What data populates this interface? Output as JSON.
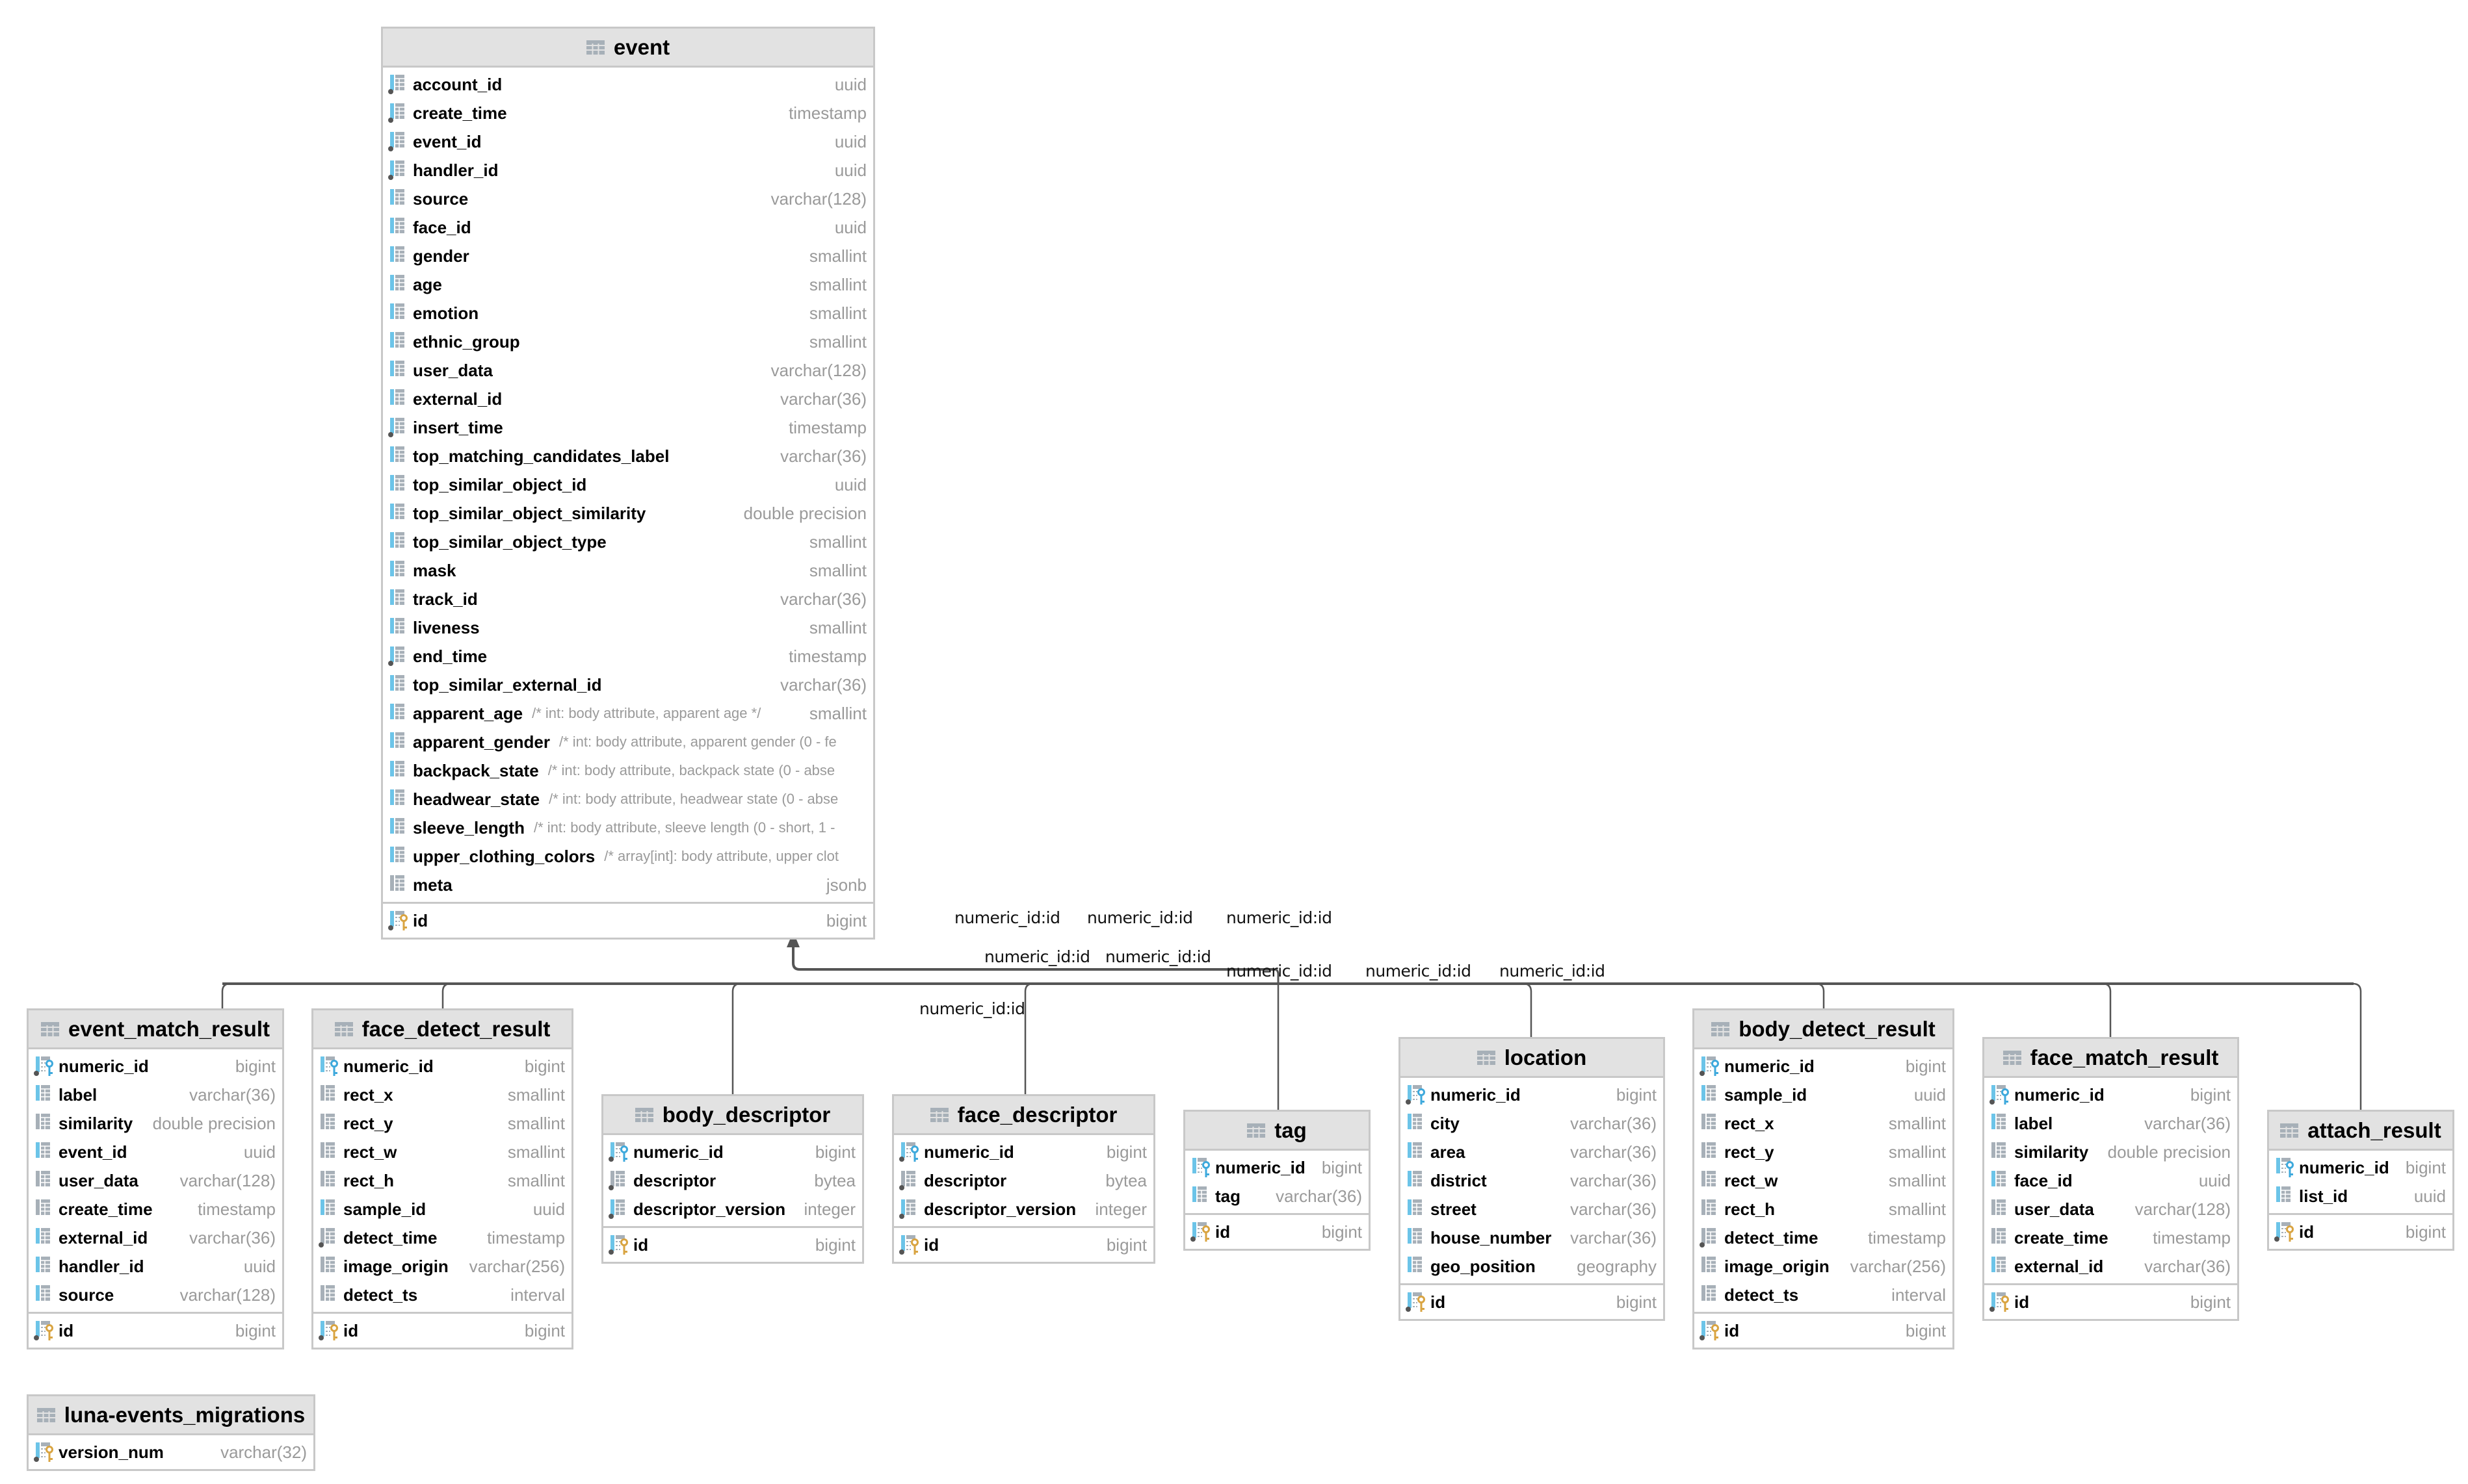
{
  "diagram": {
    "relationship_label": "numeric_id:id",
    "colors": {
      "header_bg": "#e2e2e2",
      "border": "#c8c8c8",
      "type_text": "#9a9a9a",
      "line": "#555555",
      "column_accent_blue": "#6cc4e8",
      "column_accent_gray": "#a7b0b8",
      "pk_key": "#d9a441",
      "fk_key": "#3ea9dc"
    }
  },
  "tables": {
    "event": {
      "title": "event",
      "columns": [
        {
          "name": "account_id",
          "type": "uuid",
          "icon": "column-indexed-notnull"
        },
        {
          "name": "create_time",
          "type": "timestamp",
          "icon": "column-indexed-notnull"
        },
        {
          "name": "event_id",
          "type": "uuid",
          "icon": "column-indexed-notnull"
        },
        {
          "name": "handler_id",
          "type": "uuid",
          "icon": "column-indexed-notnull"
        },
        {
          "name": "source",
          "type": "varchar(128)",
          "icon": "column-notnull"
        },
        {
          "name": "face_id",
          "type": "uuid",
          "icon": "column-notnull"
        },
        {
          "name": "gender",
          "type": "smallint",
          "icon": "column-notnull"
        },
        {
          "name": "age",
          "type": "smallint",
          "icon": "column-notnull"
        },
        {
          "name": "emotion",
          "type": "smallint",
          "icon": "column-notnull"
        },
        {
          "name": "ethnic_group",
          "type": "smallint",
          "icon": "column-notnull"
        },
        {
          "name": "user_data",
          "type": "varchar(128)",
          "icon": "column-notnull"
        },
        {
          "name": "external_id",
          "type": "varchar(36)",
          "icon": "column-notnull"
        },
        {
          "name": "insert_time",
          "type": "timestamp",
          "icon": "column-indexed-notnull"
        },
        {
          "name": "top_matching_candidates_label",
          "type": "varchar(36)",
          "icon": "column-notnull"
        },
        {
          "name": "top_similar_object_id",
          "type": "uuid",
          "icon": "column-notnull"
        },
        {
          "name": "top_similar_object_similarity",
          "type": "double precision",
          "icon": "column-notnull"
        },
        {
          "name": "top_similar_object_type",
          "type": "smallint",
          "icon": "column-notnull"
        },
        {
          "name": "mask",
          "type": "smallint",
          "icon": "column-notnull"
        },
        {
          "name": "track_id",
          "type": "varchar(36)",
          "icon": "column-notnull"
        },
        {
          "name": "liveness",
          "type": "smallint",
          "icon": "column-notnull"
        },
        {
          "name": "end_time",
          "type": "timestamp",
          "icon": "column-indexed-notnull"
        },
        {
          "name": "top_similar_external_id",
          "type": "varchar(36)",
          "icon": "column-notnull"
        },
        {
          "name": "apparent_age",
          "comment": "/* int: body attribute, apparent age */",
          "type": "smallint",
          "icon": "column-notnull"
        },
        {
          "name": "apparent_gender",
          "comment": "/* int: body attribute, apparent gender (0 - fe",
          "type": "",
          "icon": "column-notnull"
        },
        {
          "name": "backpack_state",
          "comment": "/* int: body attribute, backpack state (0 - abse",
          "type": "",
          "icon": "column-notnull"
        },
        {
          "name": "headwear_state",
          "comment": "/* int: body attribute, headwear state (0 - abse",
          "type": "",
          "icon": "column-notnull"
        },
        {
          "name": "sleeve_length",
          "comment": "/* int: body attribute, sleeve length (0 - short, 1 -",
          "type": "",
          "icon": "column-notnull"
        },
        {
          "name": "upper_clothing_colors",
          "comment": "/* array[int]: body attribute, upper clot",
          "type": "",
          "icon": "column-notnull"
        },
        {
          "name": "meta",
          "type": "jsonb",
          "icon": "column"
        }
      ],
      "pk": [
        {
          "name": "id",
          "type": "bigint",
          "icon": "primary-key"
        }
      ]
    },
    "event_match_result": {
      "title": "event_match_result",
      "columns": [
        {
          "name": "numeric_id",
          "type": "bigint",
          "icon": "foreign-key"
        },
        {
          "name": "label",
          "type": "varchar(36)",
          "icon": "column-notnull"
        },
        {
          "name": "similarity",
          "type": "double precision",
          "icon": "column"
        },
        {
          "name": "event_id",
          "type": "uuid",
          "icon": "column-notnull"
        },
        {
          "name": "user_data",
          "type": "varchar(128)",
          "icon": "column"
        },
        {
          "name": "create_time",
          "type": "timestamp",
          "icon": "column"
        },
        {
          "name": "external_id",
          "type": "varchar(36)",
          "icon": "column-notnull"
        },
        {
          "name": "handler_id",
          "type": "uuid",
          "icon": "column-notnull"
        },
        {
          "name": "source",
          "type": "varchar(128)",
          "icon": "column-notnull"
        }
      ],
      "pk": [
        {
          "name": "id",
          "type": "bigint",
          "icon": "primary-key"
        }
      ]
    },
    "face_detect_result": {
      "title": "face_detect_result",
      "columns": [
        {
          "name": "numeric_id",
          "type": "bigint",
          "icon": "foreign-key-nn"
        },
        {
          "name": "rect_x",
          "type": "smallint",
          "icon": "column"
        },
        {
          "name": "rect_y",
          "type": "smallint",
          "icon": "column"
        },
        {
          "name": "rect_w",
          "type": "smallint",
          "icon": "column"
        },
        {
          "name": "rect_h",
          "type": "smallint",
          "icon": "column"
        },
        {
          "name": "sample_id",
          "type": "uuid",
          "icon": "column-notnull"
        },
        {
          "name": "detect_time",
          "type": "timestamp",
          "icon": "column-indexed"
        },
        {
          "name": "image_origin",
          "type": "varchar(256)",
          "icon": "column"
        },
        {
          "name": "detect_ts",
          "type": "interval",
          "icon": "column"
        }
      ],
      "pk": [
        {
          "name": "id",
          "type": "bigint",
          "icon": "primary-key"
        }
      ]
    },
    "body_descriptor": {
      "title": "body_descriptor",
      "columns": [
        {
          "name": "numeric_id",
          "type": "bigint",
          "icon": "foreign-key"
        },
        {
          "name": "descriptor",
          "type": "bytea",
          "icon": "column-indexed"
        },
        {
          "name": "descriptor_version",
          "type": "integer",
          "icon": "column-indexed-notnull"
        }
      ],
      "pk": [
        {
          "name": "id",
          "type": "bigint",
          "icon": "primary-key"
        }
      ]
    },
    "face_descriptor": {
      "title": "face_descriptor",
      "columns": [
        {
          "name": "numeric_id",
          "type": "bigint",
          "icon": "foreign-key"
        },
        {
          "name": "descriptor",
          "type": "bytea",
          "icon": "column-indexed"
        },
        {
          "name": "descriptor_version",
          "type": "integer",
          "icon": "column-indexed-notnull"
        }
      ],
      "pk": [
        {
          "name": "id",
          "type": "bigint",
          "icon": "primary-key"
        }
      ]
    },
    "tag": {
      "title": "tag",
      "columns": [
        {
          "name": "numeric_id",
          "type": "bigint",
          "icon": "foreign-key-nn"
        },
        {
          "name": "tag",
          "type": "varchar(36)",
          "icon": "column-notnull"
        }
      ],
      "pk": [
        {
          "name": "id",
          "type": "bigint",
          "icon": "primary-key"
        }
      ]
    },
    "location": {
      "title": "location",
      "columns": [
        {
          "name": "numeric_id",
          "type": "bigint",
          "icon": "foreign-key"
        },
        {
          "name": "city",
          "type": "varchar(36)",
          "icon": "column-notnull"
        },
        {
          "name": "area",
          "type": "varchar(36)",
          "icon": "column-notnull"
        },
        {
          "name": "district",
          "type": "varchar(36)",
          "icon": "column-notnull"
        },
        {
          "name": "street",
          "type": "varchar(36)",
          "icon": "column-notnull"
        },
        {
          "name": "house_number",
          "type": "varchar(36)",
          "icon": "column-notnull"
        },
        {
          "name": "geo_position",
          "type": "geography",
          "icon": "column-notnull"
        }
      ],
      "pk": [
        {
          "name": "id",
          "type": "bigint",
          "icon": "primary-key"
        }
      ]
    },
    "body_detect_result": {
      "title": "body_detect_result",
      "columns": [
        {
          "name": "numeric_id",
          "type": "bigint",
          "icon": "foreign-key"
        },
        {
          "name": "sample_id",
          "type": "uuid",
          "icon": "column-notnull"
        },
        {
          "name": "rect_x",
          "type": "smallint",
          "icon": "column"
        },
        {
          "name": "rect_y",
          "type": "smallint",
          "icon": "column"
        },
        {
          "name": "rect_w",
          "type": "smallint",
          "icon": "column"
        },
        {
          "name": "rect_h",
          "type": "smallint",
          "icon": "column"
        },
        {
          "name": "detect_time",
          "type": "timestamp",
          "icon": "column-indexed"
        },
        {
          "name": "image_origin",
          "type": "varchar(256)",
          "icon": "column"
        },
        {
          "name": "detect_ts",
          "type": "interval",
          "icon": "column"
        }
      ],
      "pk": [
        {
          "name": "id",
          "type": "bigint",
          "icon": "primary-key"
        }
      ]
    },
    "face_match_result": {
      "title": "face_match_result",
      "columns": [
        {
          "name": "numeric_id",
          "type": "bigint",
          "icon": "foreign-key"
        },
        {
          "name": "label",
          "type": "varchar(36)",
          "icon": "column-notnull"
        },
        {
          "name": "similarity",
          "type": "double precision",
          "icon": "column"
        },
        {
          "name": "face_id",
          "type": "uuid",
          "icon": "column-notnull"
        },
        {
          "name": "user_data",
          "type": "varchar(128)",
          "icon": "column"
        },
        {
          "name": "create_time",
          "type": "timestamp",
          "icon": "column"
        },
        {
          "name": "external_id",
          "type": "varchar(36)",
          "icon": "column-notnull"
        }
      ],
      "pk": [
        {
          "name": "id",
          "type": "bigint",
          "icon": "primary-key"
        }
      ]
    },
    "attach_result": {
      "title": "attach_result",
      "columns": [
        {
          "name": "numeric_id",
          "type": "bigint",
          "icon": "foreign-key-nn"
        },
        {
          "name": "list_id",
          "type": "uuid",
          "icon": "column-notnull"
        }
      ],
      "pk": [
        {
          "name": "id",
          "type": "bigint",
          "icon": "primary-key"
        }
      ]
    },
    "luna_events_migrations": {
      "title": "luna-events_migrations",
      "columns": [],
      "pk": [
        {
          "name": "version_num",
          "type": "varchar(32)",
          "icon": "primary-key"
        }
      ]
    }
  },
  "relationships": [
    {
      "from": "event_match_result",
      "to": "event",
      "label": "numeric_id:id"
    },
    {
      "from": "face_detect_result",
      "to": "event",
      "label": "numeric_id:id"
    },
    {
      "from": "body_descriptor",
      "to": "event",
      "label": "numeric_id:id"
    },
    {
      "from": "face_descriptor",
      "to": "event",
      "label": "numeric_id:id"
    },
    {
      "from": "tag",
      "to": "event",
      "label": "numeric_id:id"
    },
    {
      "from": "location",
      "to": "event",
      "label": "numeric_id:id"
    },
    {
      "from": "body_detect_result",
      "to": "event",
      "label": "numeric_id:id"
    },
    {
      "from": "face_match_result",
      "to": "event",
      "label": "numeric_id:id"
    },
    {
      "from": "attach_result",
      "to": "event",
      "label": "numeric_id:id"
    }
  ]
}
